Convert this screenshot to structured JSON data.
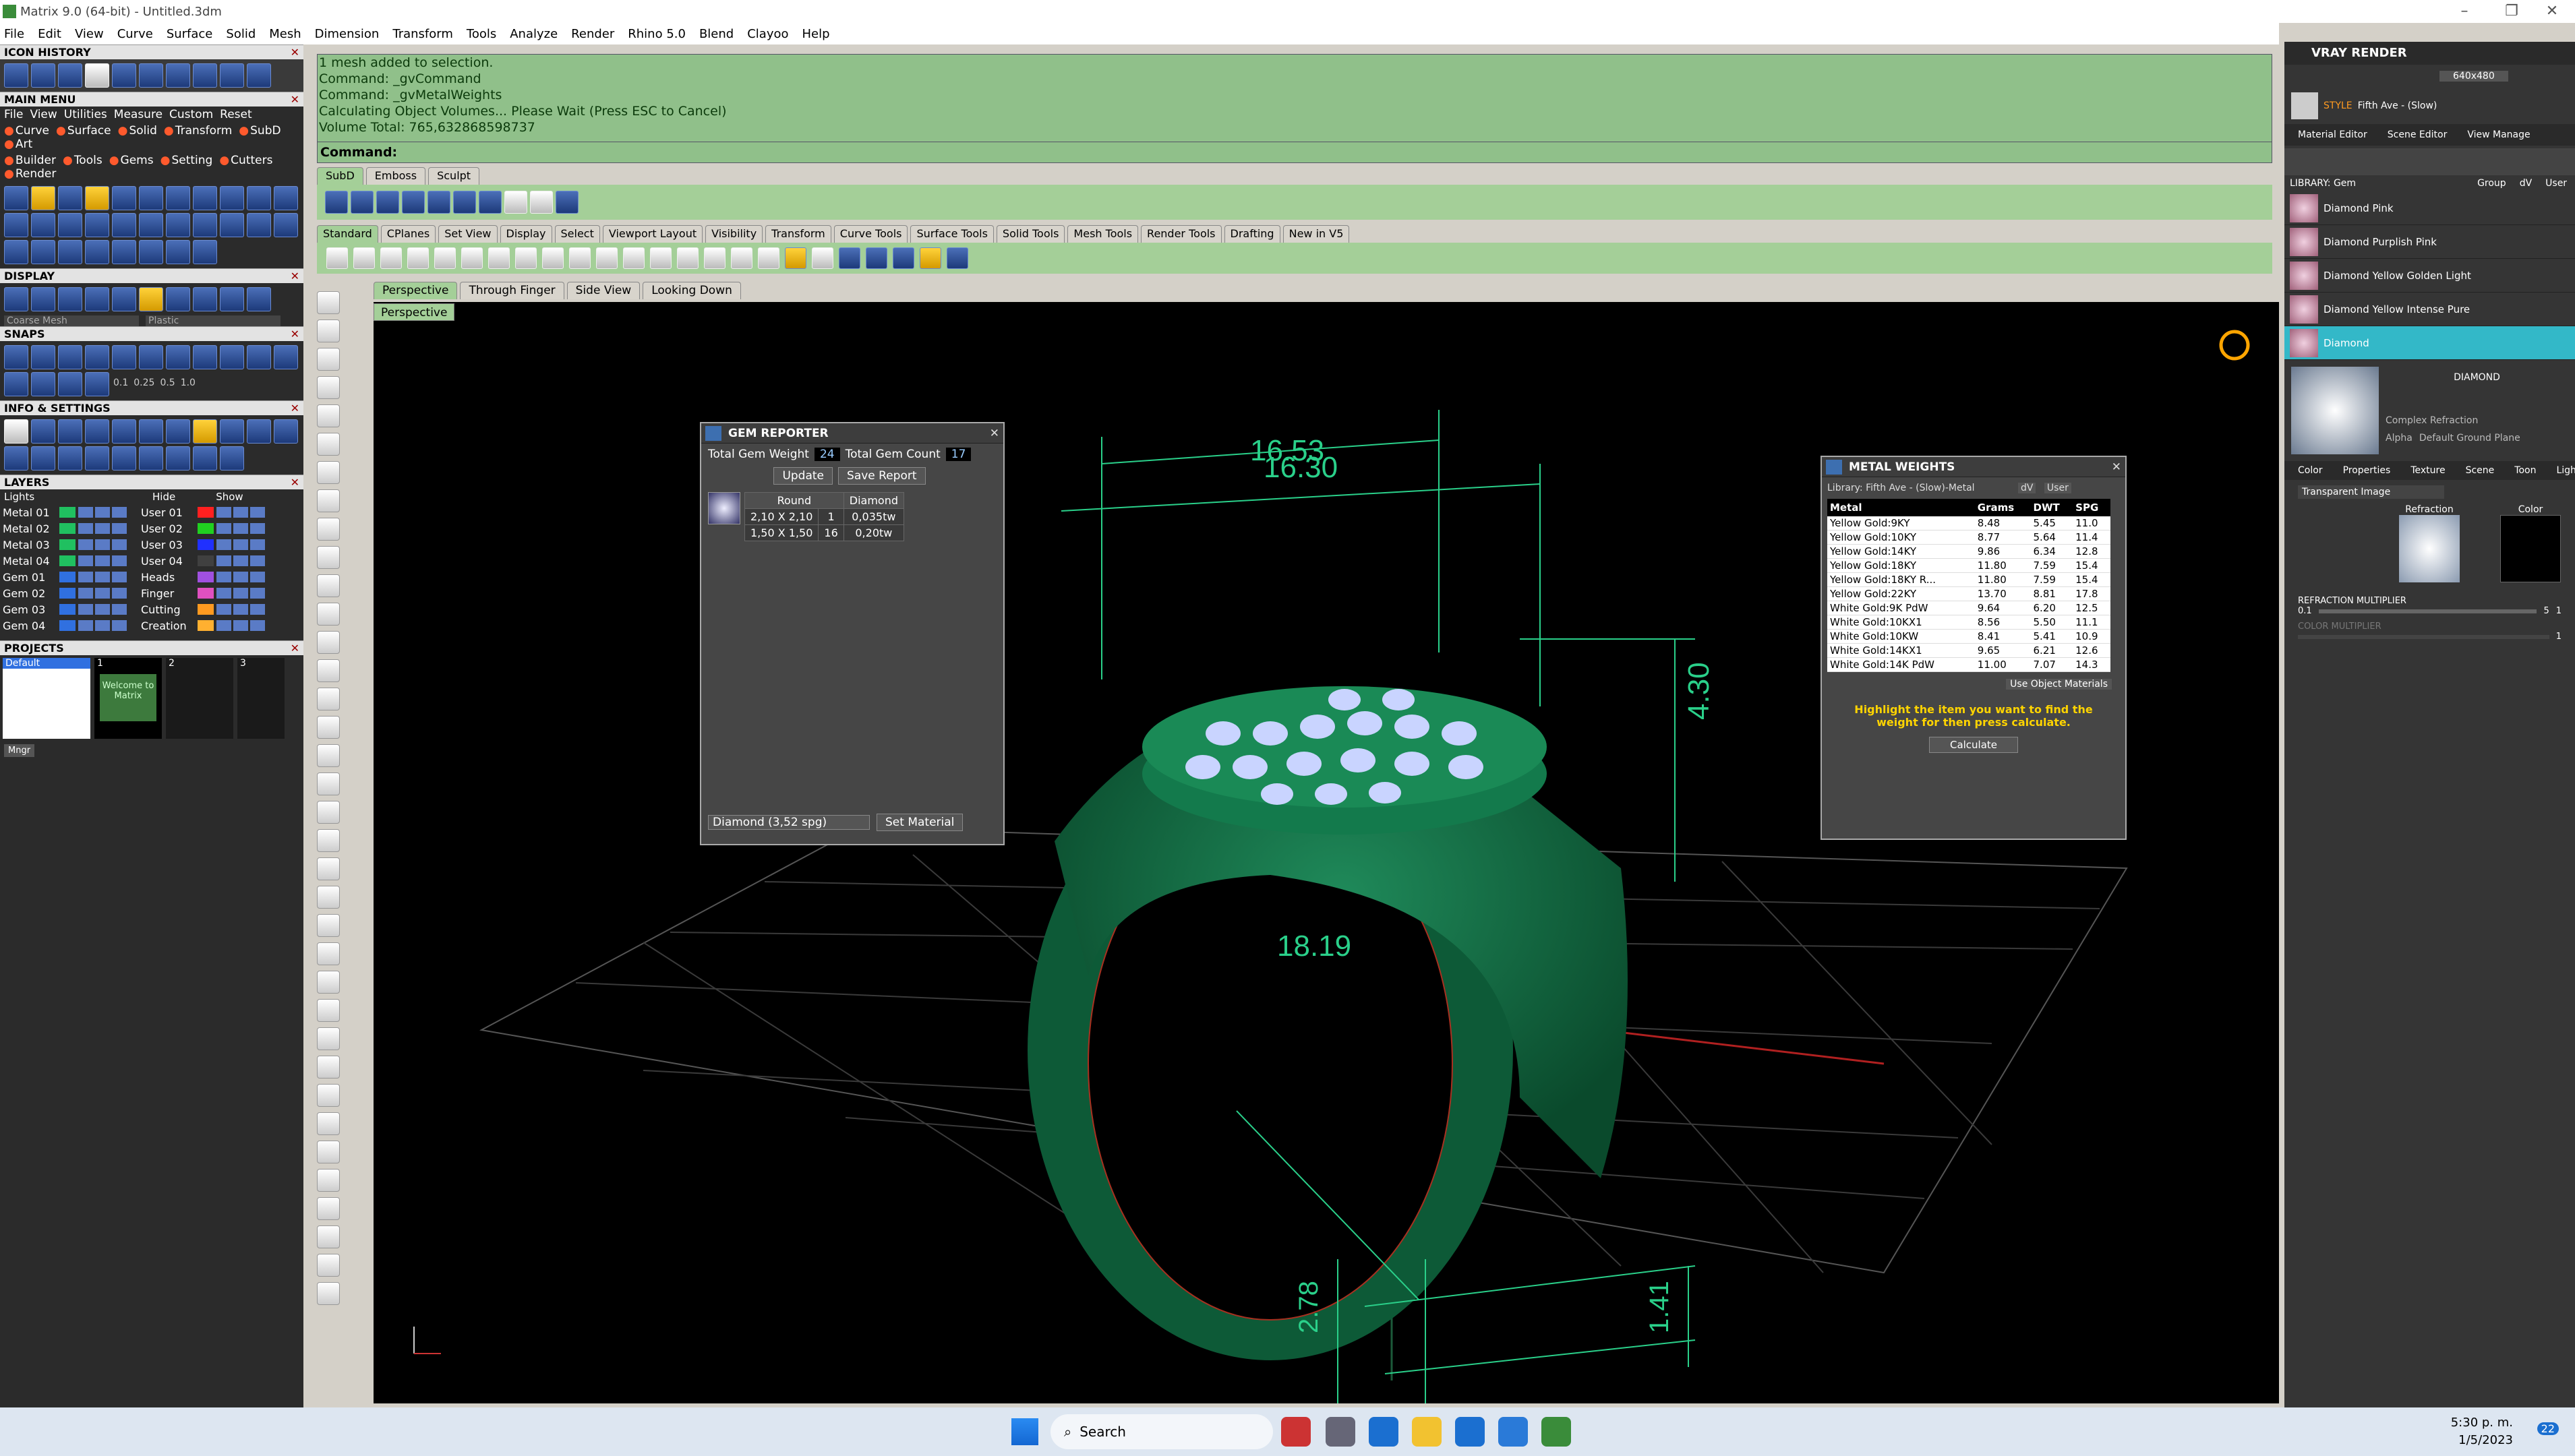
{
  "window": {
    "title": "Matrix 9.0 (64-bit) - Untitled.3dm"
  },
  "menubar": [
    "File",
    "Edit",
    "View",
    "Curve",
    "Surface",
    "Solid",
    "Mesh",
    "Dimension",
    "Transform",
    "Tools",
    "Analyze",
    "Render",
    "Rhino 5.0",
    "Blend",
    "Clayoo",
    "Help"
  ],
  "left_panel": {
    "icon_history": "ICON HISTORY",
    "main_menu": "MAIN MENU",
    "main_menu_rows": [
      [
        "File",
        "View",
        "Utilities",
        "Measure",
        "Custom",
        "Reset"
      ],
      [
        "Curve",
        "Surface",
        "Solid",
        "Transform",
        "SubD",
        "Art"
      ],
      [
        "Builder",
        "Tools",
        "Gems",
        "Setting",
        "Cutters",
        "Render"
      ]
    ],
    "display": "DISPLAY",
    "display_mode": "Coarse Mesh",
    "display_material": "Plastic",
    "snaps": "SNAPS",
    "snap_values": [
      "0.1",
      "0.25",
      "0.5",
      "1.0"
    ],
    "info_settings": "INFO & SETTINGS",
    "layers": "LAYERS",
    "layers_lights": "Lights",
    "layers_hide": "Hide",
    "layers_show": "Show",
    "layer_rows": [
      {
        "left": "Metal 01",
        "right": "User 01",
        "lc": "#20c060",
        "rc": "#ff2020"
      },
      {
        "left": "Metal 02",
        "right": "User 02",
        "lc": "#20c060",
        "rc": "#20d020"
      },
      {
        "left": "Metal 03",
        "right": "User 03",
        "lc": "#20c060",
        "rc": "#2030ff"
      },
      {
        "left": "Metal 04",
        "right": "User 04",
        "lc": "#20c060",
        "rc": "#404040"
      },
      {
        "left": "Gem 01",
        "right": "Heads",
        "lc": "#3070e0",
        "rc": "#a050e0"
      },
      {
        "left": "Gem 02",
        "right": "Finger",
        "lc": "#3070e0",
        "rc": "#e050c0"
      },
      {
        "left": "Gem 03",
        "right": "Cutting",
        "lc": "#3070e0",
        "rc": "#ff9a20"
      },
      {
        "left": "Gem 04",
        "right": "Creation",
        "lc": "#3070e0",
        "rc": "#ffb030"
      }
    ],
    "projects": "PROJECTS",
    "project_default": "Default",
    "project_slots": [
      "1",
      "2",
      "3"
    ],
    "welcome": "Welcome to Matrix",
    "mngr": "Mngr"
  },
  "command": {
    "lines": [
      "1 mesh added to selection.",
      "Command: _gvCommand",
      "Command: _gvMetalWeights",
      "Calculating Object Volumes... Please Wait (Press ESC to Cancel)",
      "Volume Total: 765,632868598737"
    ],
    "prompt": "Command:"
  },
  "ribbon_tabs_1": [
    "SubD",
    "Emboss",
    "Sculpt"
  ],
  "ribbon_tabs_2": [
    "Standard",
    "CPlanes",
    "Set View",
    "Display",
    "Select",
    "Viewport Layout",
    "Visibility",
    "Transform",
    "Curve Tools",
    "Surface Tools",
    "Solid Tools",
    "Mesh Tools",
    "Render Tools",
    "Drafting",
    "New in V5"
  ],
  "viewport_tabs": [
    "Perspective",
    "Through Finger",
    "Side View",
    "Looking Down"
  ],
  "viewport_label": "Perspective",
  "dimensions": {
    "top": "16.53",
    "top2": "16.30",
    "height": "4.30",
    "inner": "18.19",
    "thick": "2.78",
    "side": "1.41"
  },
  "gem_reporter": {
    "title": "GEM REPORTER",
    "total_weight_label": "Total Gem Weight",
    "total_weight": "24",
    "total_count_label": "Total Gem Count",
    "total_count": "17",
    "update": "Update",
    "save_report": "Save Report",
    "cols": [
      "Round",
      "Diamond"
    ],
    "rows": [
      [
        "2,10 X 2,10",
        "1",
        "0,035tw"
      ],
      [
        "1,50 X 1,50",
        "16",
        "0,20tw"
      ]
    ],
    "material": "Diamond (3,52 spg)",
    "set_material": "Set Material"
  },
  "metal_weights": {
    "title": "METAL WEIGHTS",
    "library": "Library: Fifth Ave - (Slow)-Metal",
    "dv": "dV",
    "user": "User",
    "headers": [
      "Metal",
      "Grams",
      "DWT",
      "SPG"
    ],
    "rows": [
      [
        "Yellow Gold:9KY",
        "8.48",
        "5.45",
        "11.0"
      ],
      [
        "Yellow Gold:10KY",
        "8.77",
        "5.64",
        "11.4"
      ],
      [
        "Yellow Gold:14KY",
        "9.86",
        "6.34",
        "12.8"
      ],
      [
        "Yellow Gold:18KY",
        "11.80",
        "7.59",
        "15.4"
      ],
      [
        "Yellow Gold:18KY R...",
        "11.80",
        "7.59",
        "15.4"
      ],
      [
        "Yellow Gold:22KY",
        "13.70",
        "8.81",
        "17.8"
      ],
      [
        "White Gold:9K PdW",
        "9.64",
        "6.20",
        "12.5"
      ],
      [
        "White Gold:10KX1",
        "8.56",
        "5.50",
        "11.1"
      ],
      [
        "White Gold:10KW",
        "8.41",
        "5.41",
        "10.9"
      ],
      [
        "White Gold:14KX1",
        "9.65",
        "6.21",
        "12.6"
      ],
      [
        "White Gold:14K PdW",
        "11.00",
        "7.07",
        "14.3"
      ]
    ],
    "use_object_materials": "Use Object Materials",
    "hint": "Highlight the item you want to find the weight for then press calculate.",
    "calculate": "Calculate"
  },
  "vray": {
    "title": "VRAY RENDER",
    "resolution": "640x480",
    "style": "STYLE",
    "style_value": "Fifth Ave - (Slow)",
    "tabs": [
      "Material Editor",
      "Scene Editor",
      "View Manage"
    ],
    "library_label": "LIBRARY: Gem",
    "group": "Group",
    "dv": "dV",
    "user": "User",
    "materials": [
      "Diamond Pink",
      "Diamond Purplish Pink",
      "Diamond Yellow Golden Light",
      "Diamond Yellow Intense Pure",
      "Diamond"
    ],
    "selected_material": "DIAMOND",
    "complex_refraction": "Complex Refraction",
    "alpha": "Alpha",
    "default_ground": "Default Ground Plane",
    "sub_tabs": [
      "Color",
      "Properties",
      "Texture",
      "Scene",
      "Toon",
      "Light"
    ],
    "transparent_image": "Transparent Image",
    "refraction": "Refraction",
    "color": "Color",
    "refraction_multiplier": "REFRACTION MULTIPLIER",
    "rm_value": "1",
    "rm_min": "0.1",
    "rm_max": "5",
    "color_multiplier": "COLOR MULTIPLIER",
    "cm_value": "1"
  },
  "taskbar": {
    "search": "Search",
    "time": "5:30 p. m.",
    "date": "1/5/2023",
    "badge": "22"
  }
}
